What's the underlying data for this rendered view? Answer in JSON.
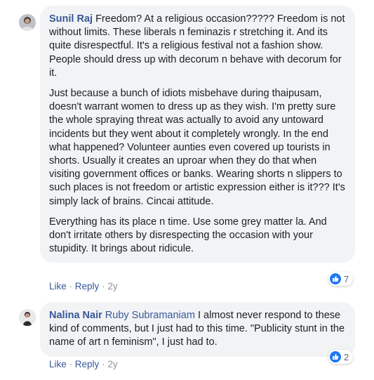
{
  "comments": [
    {
      "author": "Sunil Raj",
      "paragraphs": [
        "Freedom? At a religious occasion????? Freedom is not without limits. These liberals n feminazis r stretching it. And its quite disrespectful. It's a religious festival not a fashion show. People should dress up with decorum n behave with decorum for it.",
        "Just because a bunch of idiots misbehave during thaipusam, doesn't warrant women to dress up as they wish. I'm pretty sure the whole spraying threat was actually to avoid any untoward incidents but they went about it completely wrongly. In the end what happened? Volunteer aunties even covered up tourists in shorts. Usually it creates an uproar when they do that when visiting government offices or banks. Wearing shorts n slippers to such places is not freedom or artistic expression either is it??? It's simply lack of brains. Cincai attitude.",
        "Everything has its place n time. Use some grey matter la. And don't irritate others by disrespecting the occasion with your stupidity. It brings about ridicule."
      ],
      "actions": {
        "like": "Like",
        "reply": "Reply",
        "time": "2y"
      },
      "reaction_count": "7",
      "reaction_icon": "like-icon"
    },
    {
      "author": "Nalina Nair",
      "mention": "Ruby Subramaniam",
      "text": "I almost never respond to these kind of comments, but I just had to this time. \"Publicity stunt in the name of art n feminism\", I just had to.",
      "actions": {
        "like": "Like",
        "reply": "Reply",
        "time": "2y"
      },
      "reaction_count": "2",
      "reaction_icon": "like-icon"
    }
  ],
  "separator": "·",
  "colors": {
    "link": "#385898",
    "bubble": "#f2f3f5",
    "like_blue": "#2078f4",
    "meta": "#90949c"
  }
}
